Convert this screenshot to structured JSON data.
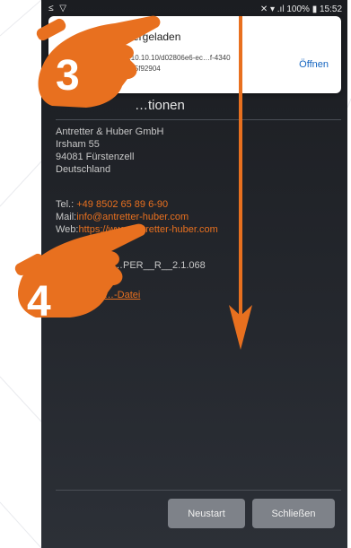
{
  "status_bar": {
    "left_icons": "≤ ▽",
    "right_text": "✕ ▾ .ıl 100% ▮ 15:52"
  },
  "notification": {
    "title": "…ntergeladen",
    "url_line1": "…://10.10.10.10/d02806e6-ec…f-4340",
    "url_line2": "…c5eed5f92904",
    "action": "Öffnen"
  },
  "section": {
    "title": "…tionen"
  },
  "company": {
    "name": "Antretter & Huber GmbH",
    "street": "Irsham 55",
    "city": "94081 Fürstenzell",
    "country": "Deutschland"
  },
  "contact": {
    "tel_label": "Tel.:",
    "tel_value": "+49 8502 65 89 6-90",
    "mail_label": "Mail:",
    "mail_value": "info@antretter-huber.com",
    "web_label": "Web:",
    "web_value": "https://www.antretter-huber.com"
  },
  "version": "…PER__R__2.1.068",
  "file_link": "…-Datei",
  "buttons": {
    "restart": "Neustart",
    "close": "Schließen"
  },
  "overlays": {
    "step3": "3",
    "step4": "4",
    "accent_color": "#e8701f"
  }
}
